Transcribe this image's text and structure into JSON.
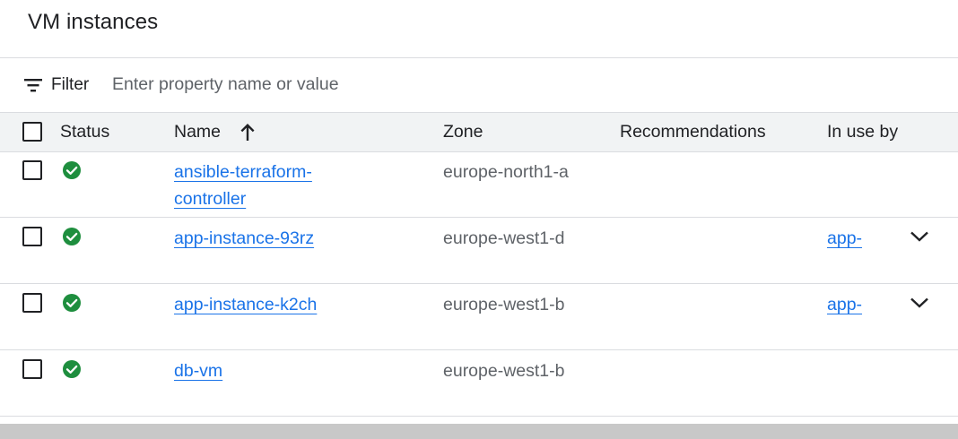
{
  "page": {
    "title": "VM instances"
  },
  "filter": {
    "label": "Filter",
    "placeholder": "Enter property name or value",
    "value": ""
  },
  "table": {
    "columns": {
      "status": "Status",
      "name": "Name",
      "zone": "Zone",
      "recommendations": "Recommendations",
      "in_use_by": "In use by"
    },
    "sort": {
      "column": "name",
      "direction": "ascending",
      "icon": "arrow-up-icon"
    },
    "rows": [
      {
        "status": "running",
        "status_icon": "check-circle-icon",
        "name_line1": "ansible-terraform-",
        "name_line2": "controller",
        "zone": "europe-north1-a",
        "recommendations": "",
        "in_use_by": ""
      },
      {
        "status": "running",
        "status_icon": "check-circle-icon",
        "name_line1": "app-instance-93rz",
        "name_line2": "",
        "zone": "europe-west1-d",
        "recommendations": "",
        "in_use_by": "app-"
      },
      {
        "status": "running",
        "status_icon": "check-circle-icon",
        "name_line1": "app-instance-k2ch",
        "name_line2": "",
        "zone": "europe-west1-b",
        "recommendations": "",
        "in_use_by": "app-"
      },
      {
        "status": "running",
        "status_icon": "check-circle-icon",
        "name_line1": "db-vm",
        "name_line2": "",
        "zone": "europe-west1-b",
        "recommendations": "",
        "in_use_by": ""
      }
    ]
  },
  "colors": {
    "link": "#1a73e8",
    "status_ok": "#1e8e3e",
    "header_bg": "#f1f3f4",
    "divider": "#dadce0",
    "secondary_text": "#5f6368"
  }
}
